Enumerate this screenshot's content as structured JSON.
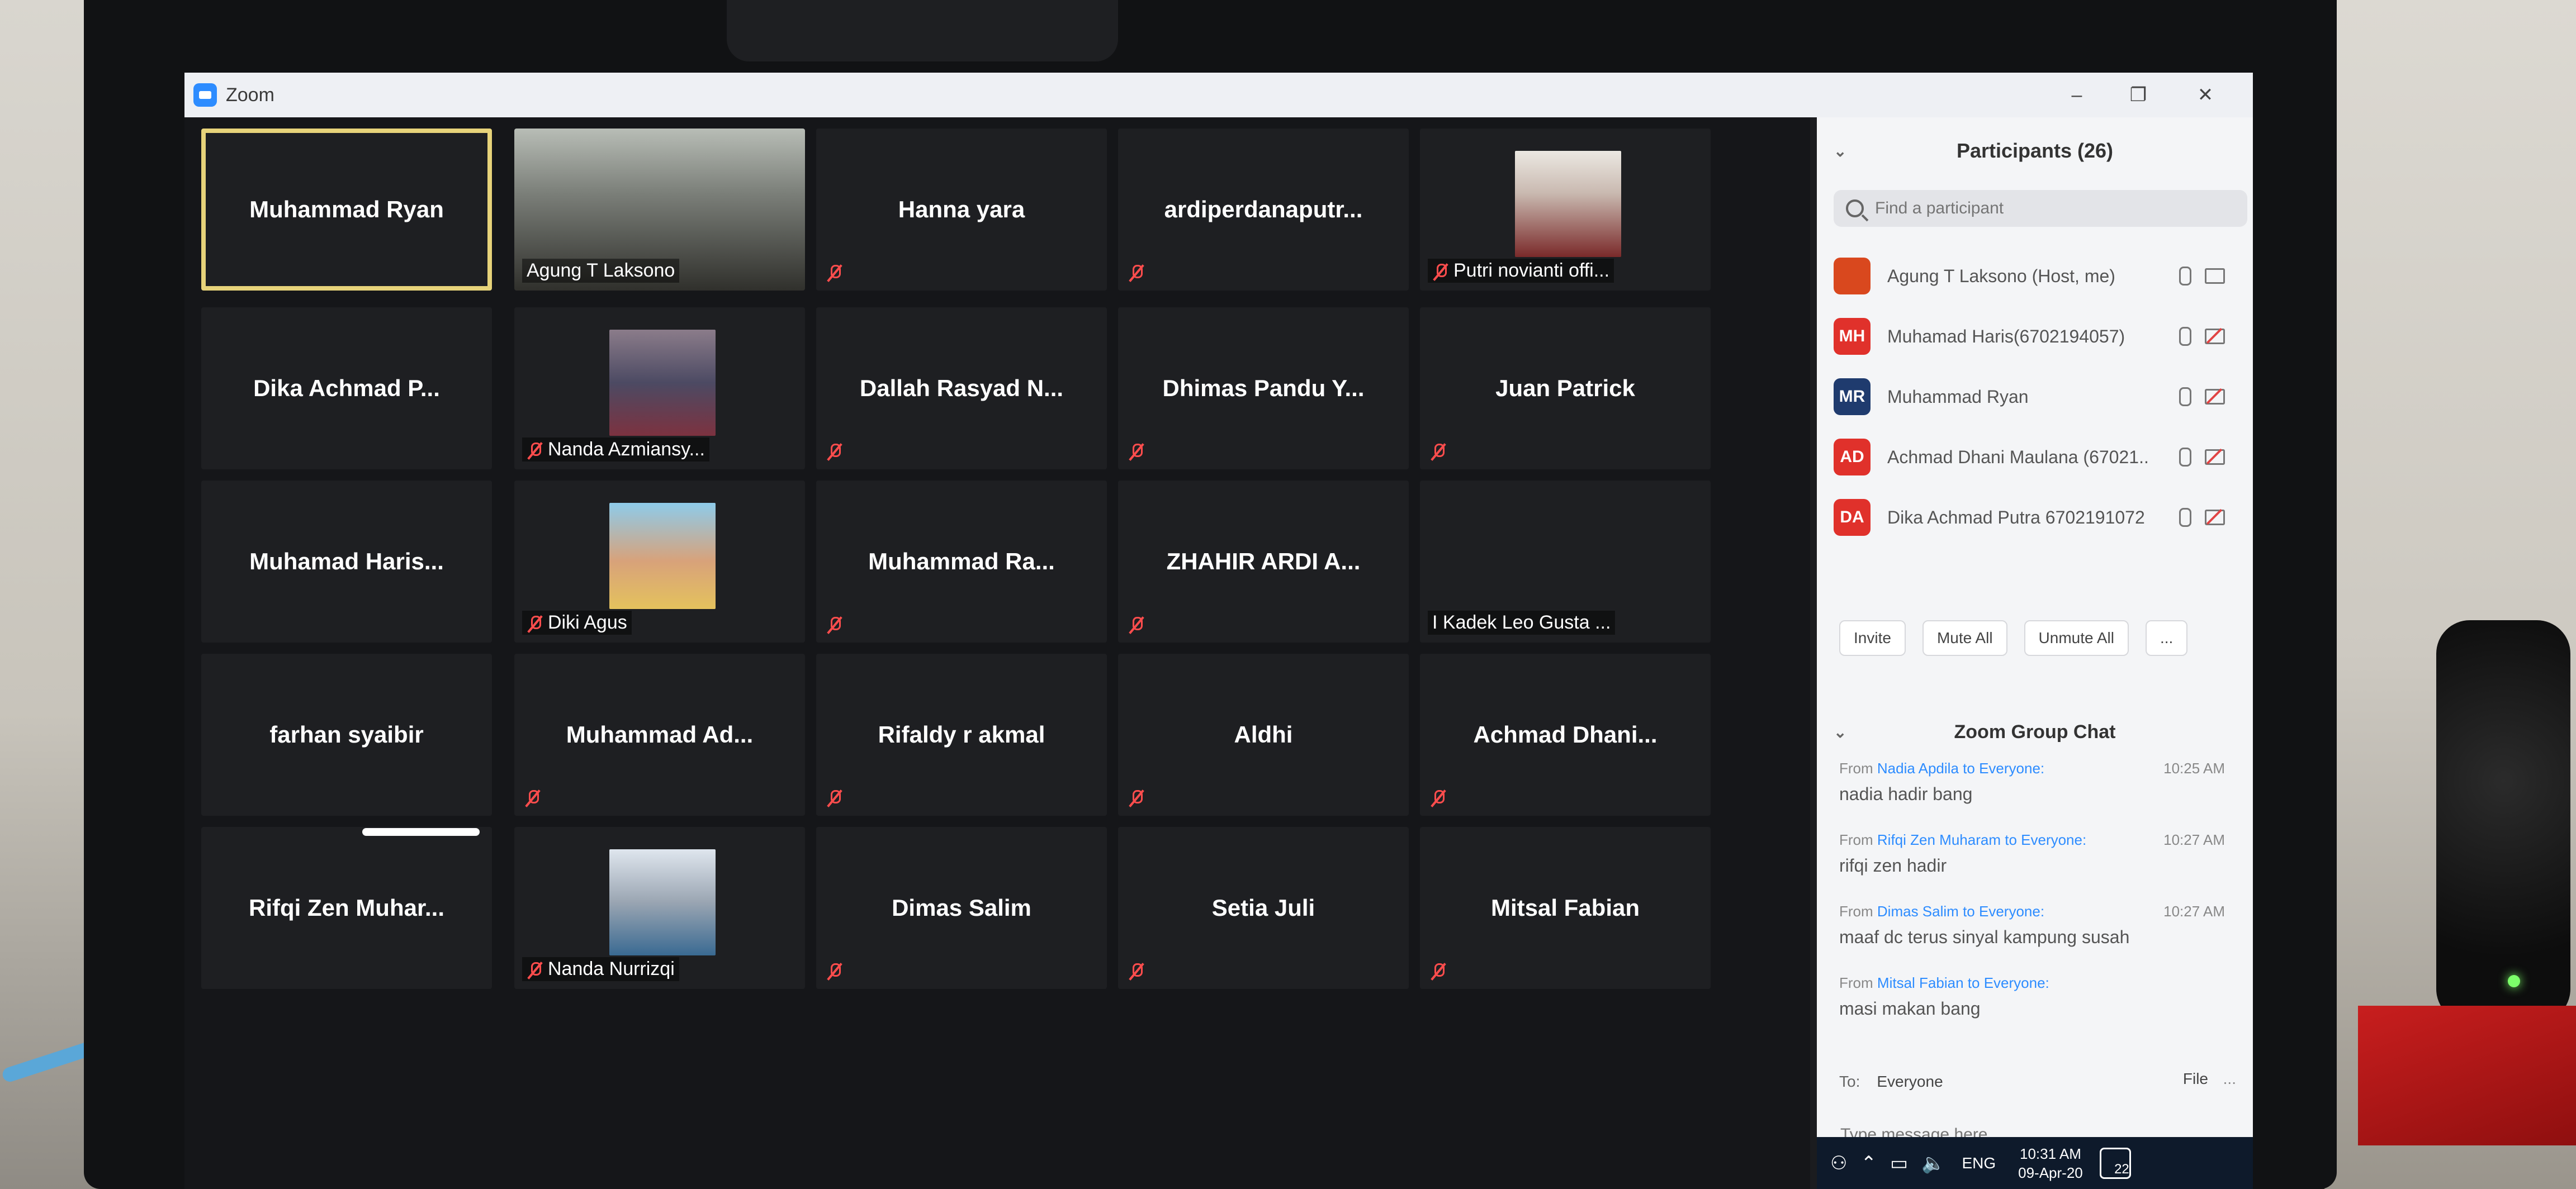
{
  "window": {
    "title": "Zoom",
    "minimize": "–",
    "restore": "❐",
    "close": "✕"
  },
  "tiles": [
    {
      "name": "Muhammad Ryan",
      "type": "center",
      "active": true
    },
    {
      "name": "Agung T Laksono",
      "type": "video"
    },
    {
      "name": "Hanna yara",
      "type": "center",
      "muted": true
    },
    {
      "name": "ardiperdanaputr...",
      "type": "center",
      "muted": true
    },
    {
      "name": "Putri novianti offi...",
      "type": "photo",
      "muted": true
    },
    {
      "name": "Dika Achmad P...",
      "type": "center"
    },
    {
      "name": "Nanda Azmiansy...",
      "type": "photo",
      "muted": true
    },
    {
      "name": "Dallah Rasyad N...",
      "type": "center",
      "muted": true
    },
    {
      "name": "Dhimas Pandu Y...",
      "type": "center",
      "muted": true
    },
    {
      "name": "Juan Patrick",
      "type": "center",
      "muted": true
    },
    {
      "name": "Muhamad Haris...",
      "type": "center"
    },
    {
      "name": "Diki Agus",
      "type": "photo",
      "muted": true
    },
    {
      "name": "Muhammad Ra...",
      "type": "center",
      "muted": true
    },
    {
      "name": "ZHAHIR ARDI A...",
      "type": "center",
      "muted": true
    },
    {
      "name": "I Kadek Leo Gusta ...",
      "type": "label"
    },
    {
      "name": "farhan syaibir",
      "type": "center"
    },
    {
      "name": "Muhammad Ad...",
      "type": "center",
      "muted": true
    },
    {
      "name": "Rifaldy r akmal",
      "type": "center",
      "muted": true
    },
    {
      "name": "Aldhi",
      "type": "center",
      "muted": true
    },
    {
      "name": "Achmad Dhani...",
      "type": "center",
      "muted": true
    },
    {
      "name": "Rifqi Zen Muhar...",
      "type": "center"
    },
    {
      "name": "Nanda Nurrizqi",
      "type": "photo",
      "muted": true
    },
    {
      "name": "Dimas Salim",
      "type": "center",
      "muted": true
    },
    {
      "name": "Setia Juli",
      "type": "center",
      "muted": true
    },
    {
      "name": "Mitsal Fabian",
      "type": "center",
      "muted": true
    }
  ],
  "participants": {
    "title": "Participants (26)",
    "search_placeholder": "Find a participant",
    "list": [
      {
        "initials": "",
        "name": "Agung T Laksono (Host, me)",
        "color": "#d9481e",
        "cam_off": false
      },
      {
        "initials": "MH",
        "name": "Muhamad Haris(6702194057)",
        "color": "#e0312b",
        "cam_off": true
      },
      {
        "initials": "MR",
        "name": "Muhammad Ryan",
        "color": "#1f3b6e",
        "cam_off": true
      },
      {
        "initials": "AD",
        "name": "Achmad Dhani Maulana (67021...",
        "color": "#e0312b",
        "cam_off": true
      },
      {
        "initials": "DA",
        "name": "Dika Achmad Putra 6702191072",
        "color": "#e0312b",
        "cam_off": true
      }
    ],
    "buttons": {
      "invite": "Invite",
      "mute_all": "Mute All",
      "unmute_all": "Unmute All",
      "more": "..."
    }
  },
  "chat": {
    "title": "Zoom Group Chat",
    "messages": [
      {
        "from": "Nadia Apdila",
        "to": "Everyone",
        "time": "10:25 AM",
        "text": "nadia hadir bang"
      },
      {
        "from": "Rifqi Zen Muharam",
        "to": "Everyone",
        "time": "10:27 AM",
        "text": "rifqi zen hadir"
      },
      {
        "from": "Dimas Salim",
        "to": "Everyone",
        "time": "10:27 AM",
        "text": "maaf dc terus sinyal kampung susah"
      },
      {
        "from": "Mitsal Fabian",
        "to": "Everyone",
        "time": "",
        "text": "masi makan bang"
      }
    ],
    "from_label": "From",
    "to_word": "to",
    "to_label": "To:",
    "to_value": "Everyone",
    "file_label": "File",
    "more": "...",
    "input_placeholder": "Type message here..."
  },
  "taskbar": {
    "language": "ENG",
    "time": "10:31 AM",
    "date": "09-Apr-20",
    "notifications": "22"
  }
}
